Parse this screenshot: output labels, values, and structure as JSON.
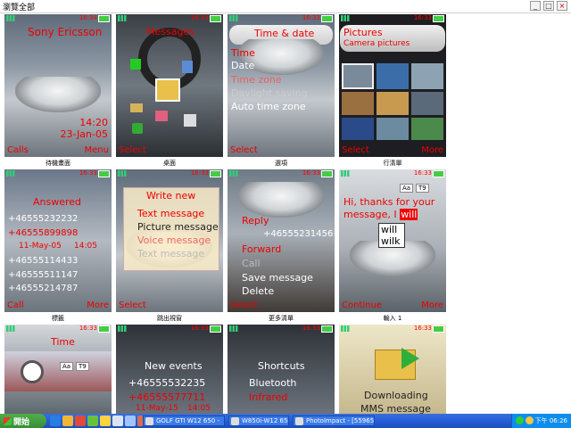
{
  "window": {
    "title": "瀏覽全部"
  },
  "window_buttons": [
    "_",
    "□",
    "×"
  ],
  "screens": [
    {
      "status_time": "16:34",
      "title": "Sony Ericsson",
      "clock": "14:20",
      "date": "23-Jan-05",
      "left": "Calls",
      "right": "Menu",
      "caption": "待機畫面"
    },
    {
      "status_time": "16:33",
      "title": "Messages",
      "left": "Select",
      "caption": "桌面"
    },
    {
      "status_time": "16:33",
      "title": "Time & date",
      "items": [
        "Time",
        "Date",
        "Time zone",
        "Daylight saving",
        "Auto time zone"
      ],
      "left": "Select",
      "caption": "選項"
    },
    {
      "status_time": "16:33",
      "title": "Pictures",
      "subtitle": "Camera pictures",
      "left": "Select",
      "right": "More",
      "caption": "行清單"
    },
    {
      "status_time": "16:33",
      "title": "Answered",
      "calls": [
        "+46555232232",
        "+46555899898",
        "11-May-05",
        "14:05",
        "+46555114433",
        "+46555511147",
        "+46555214787"
      ],
      "left": "Call",
      "right": "More",
      "caption": "標籤"
    },
    {
      "status_time": "16:33",
      "title": "Write new",
      "items": [
        "Text message",
        "Picture message",
        "Voice message",
        "Text message"
      ],
      "left": "Select",
      "caption": "跳出視窗"
    },
    {
      "status_time": "16:33",
      "number": "+46555231456",
      "items": [
        "Reply",
        "Forward",
        "Call",
        "Save message",
        "Delete"
      ],
      "left": "Select",
      "caption": "更多清單"
    },
    {
      "status_time": "16:33",
      "message": "Hi, thanks for your message, I",
      "highlight": "will",
      "abc_label": "Aa",
      "t9_label": "T9",
      "suggestions": [
        "will",
        "wilk"
      ],
      "left": "Continue",
      "right": "More",
      "caption": "輸入 1"
    },
    {
      "status_time": "16:33",
      "title": "Time",
      "abc_label": "Aa",
      "t9_label": "T9"
    },
    {
      "status_time": "16:33",
      "title": "New events",
      "lines": [
        "+46555532235",
        "+46555577711",
        "11-May-15",
        "14:05"
      ]
    },
    {
      "status_time": "16:33",
      "title": "Shortcuts",
      "items": [
        "Bluetooth",
        "Infrared"
      ]
    },
    {
      "status_time": "16:33",
      "lines": [
        "Downloading",
        "MMS message"
      ]
    }
  ],
  "taskbar": {
    "start": "開始",
    "tasks": [
      "GOLF GTI W12 650 -",
      "W850i-W12 650 thu...",
      "PhotoImpact - [55965..."
    ],
    "clock": "下午 06:26"
  }
}
